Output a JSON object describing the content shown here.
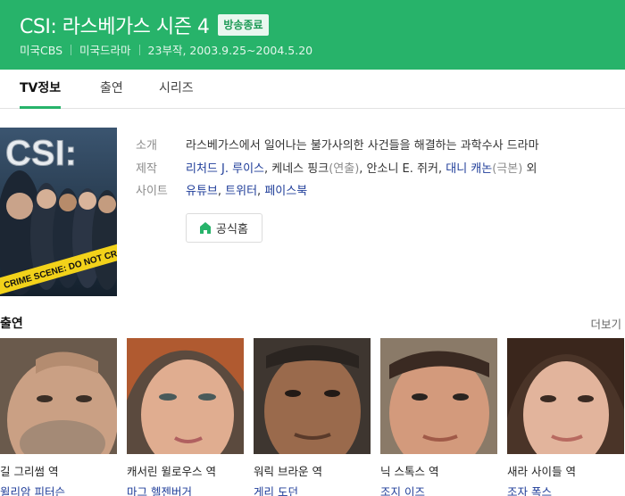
{
  "header": {
    "title": "CSI: 라스베가스 시즌 4",
    "badge": "방송종료",
    "meta": [
      "미국CBS",
      "미국드라마",
      "23부작, 2003.9.25~2004.5.20"
    ],
    "bg_color": "#27b36a"
  },
  "tabs": [
    {
      "label": "TV정보",
      "active": true
    },
    {
      "label": "출연",
      "active": false
    },
    {
      "label": "시리즈",
      "active": false
    }
  ],
  "poster": {
    "logo_text": "CSI:",
    "banner_text": "CRIME SCENE: DO NOT CROSS"
  },
  "info": {
    "intro_label": "소개",
    "intro_value": "라스베가스에서 일어나는 불가사의한 사건들을 해결하는 과학수사 드라마",
    "production_label": "제작",
    "production": {
      "person1": "리처드 J. 루이스",
      "person2": "케네스 핑크",
      "person2_role": "(연출)",
      "person3": "안소니 E. 쥐커",
      "person4": "대니 캐논",
      "person4_role": "(극본)",
      "suffix": "외"
    },
    "site_label": "사이트",
    "sites": [
      "유튜브",
      "트위터",
      "페이스북"
    ],
    "home_button": "공식홈"
  },
  "cast_section": {
    "title": "출연",
    "more": "더보기",
    "members": [
      {
        "role": "길 그리썸 역",
        "actor": "윌리암 피터슨"
      },
      {
        "role": "캐서린 윌로우스 역",
        "actor": "마그 헬젠버거"
      },
      {
        "role": "워릭 브라운 역",
        "actor": "게리 도던"
      },
      {
        "role": "닉 스톡스 역",
        "actor": "조지 이즈"
      },
      {
        "role": "새라 사이들 역",
        "actor": "조자 폭스"
      }
    ]
  }
}
